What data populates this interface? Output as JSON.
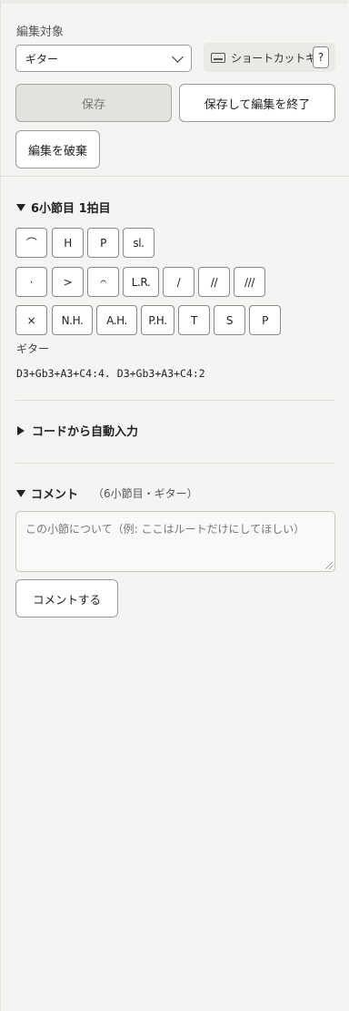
{
  "edit_target": {
    "label": "編集対象",
    "selected": "ギター"
  },
  "shortcut": {
    "label": "ショートカットキー",
    "help": "?"
  },
  "actions": {
    "save": "保存",
    "save_exit": "保存して編集を終了",
    "discard": "編集を破棄"
  },
  "beat_section": {
    "title": "6小節目 1拍目",
    "row1": [
      "⌒",
      "H",
      "P",
      "sl."
    ],
    "row2": [
      "·",
      ">",
      "𝄐",
      "L.R.",
      "/",
      "//",
      "///"
    ],
    "row3": [
      "×",
      "N.H.",
      "A.H.",
      "P.H.",
      "T",
      "S",
      "P"
    ],
    "instrument": "ギター",
    "notation": "D3+Gb3+A3+C4:4. D3+Gb3+A3+C4:2"
  },
  "auto_input": {
    "title": "コードから自動入力"
  },
  "comment": {
    "title": "コメント",
    "context": "（6小節目・ギター）",
    "placeholder": "この小節について（例: ここはルートだけにしてほしい）",
    "submit": "コメントする"
  }
}
